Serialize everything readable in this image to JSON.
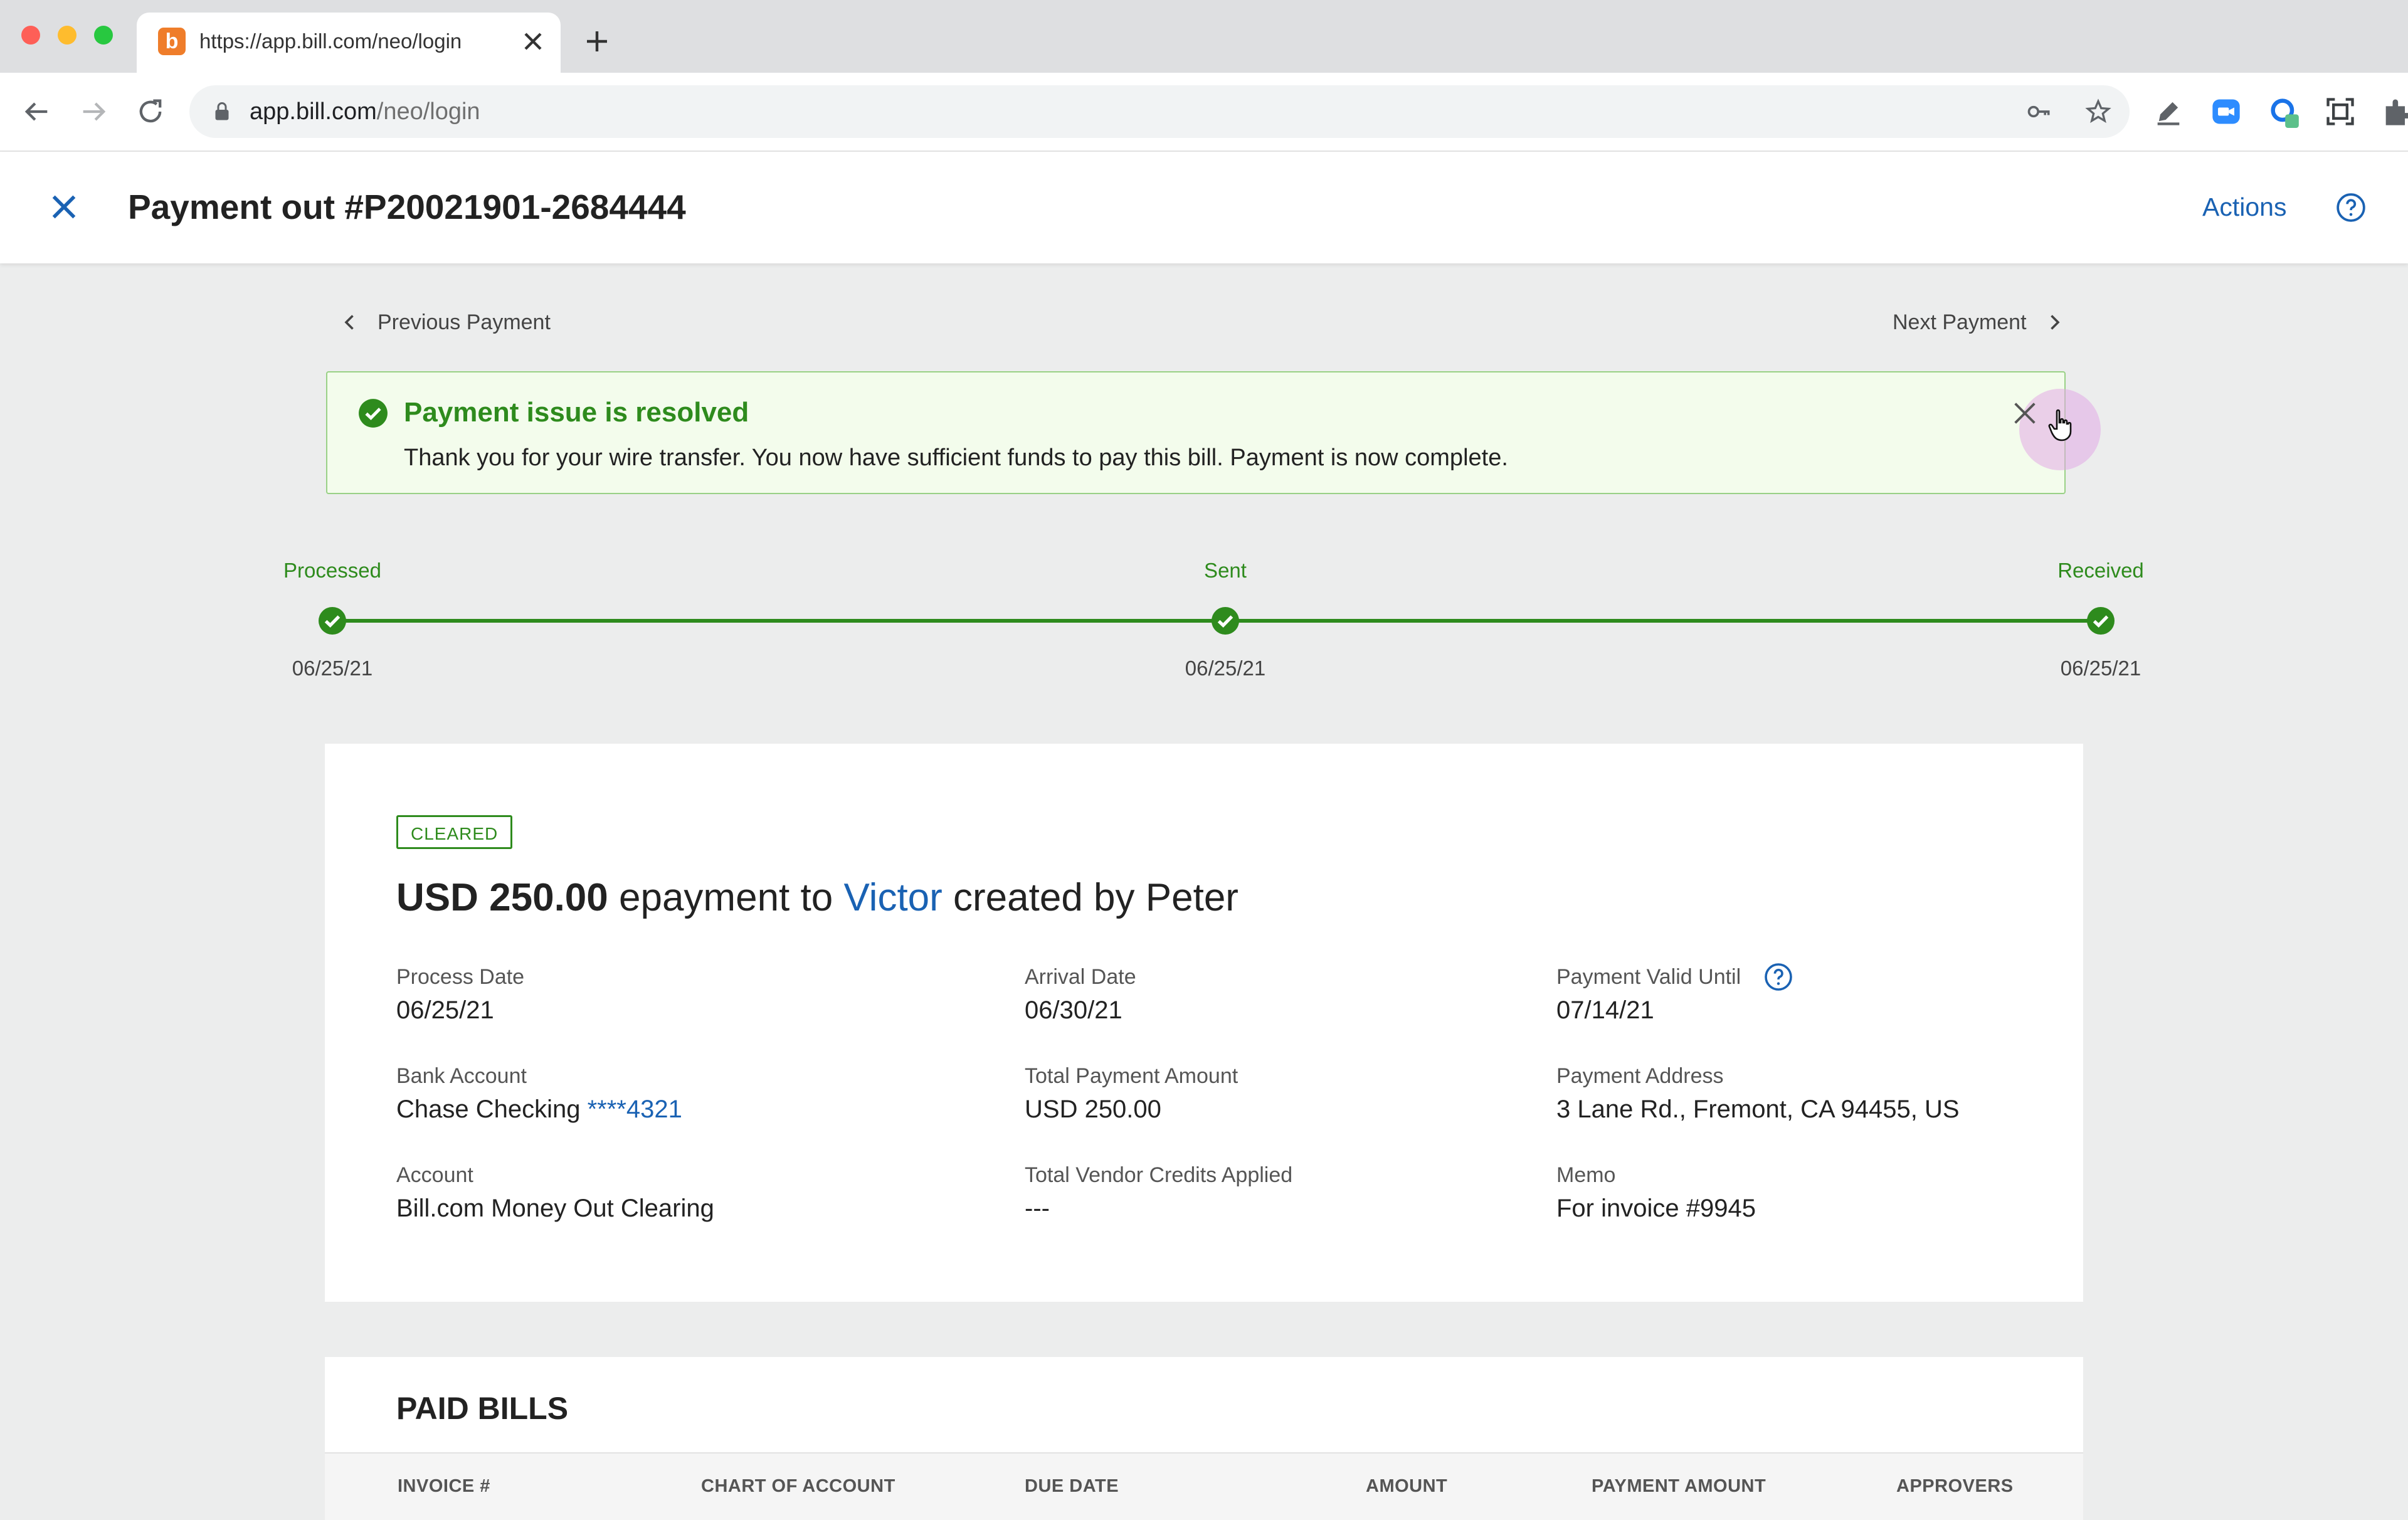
{
  "browser": {
    "tab_title": "https://app.bill.com/neo/login",
    "favicon_letter": "b",
    "url_host": "app.bill.com",
    "url_path": "/neo/login"
  },
  "header": {
    "title": "Payment out #P20021901-2684444",
    "actions_label": "Actions"
  },
  "pager": {
    "previous_label": "Previous Payment",
    "next_label": "Next Payment"
  },
  "alert": {
    "title": "Payment issue is resolved",
    "message": "Thank you for your wire transfer. You now have sufficient funds to pay this bill. Payment is now complete."
  },
  "timeline": {
    "steps": [
      {
        "label": "Processed",
        "date": "06/25/21"
      },
      {
        "label": "Sent",
        "date": "06/25/21"
      },
      {
        "label": "Received",
        "date": "06/25/21"
      }
    ]
  },
  "payment": {
    "status_badge": "CLEARED",
    "amount": "USD 250.00",
    "mid_text": " epayment to ",
    "vendor": "Victor",
    "creator_text": " created by Peter",
    "fields": {
      "process_date": {
        "label": "Process Date",
        "value": "06/25/21"
      },
      "arrival_date": {
        "label": "Arrival Date",
        "value": "06/30/21"
      },
      "valid_until": {
        "label": "Payment Valid Until",
        "value": "07/14/21"
      },
      "bank_account": {
        "label": "Bank Account",
        "value": "Chase Checking ",
        "link": "****4321"
      },
      "total_amount": {
        "label": "Total Payment Amount",
        "value": "USD 250.00"
      },
      "payment_address": {
        "label": "Payment Address",
        "value": "3 Lane Rd., Fremont, CA 94455, US"
      },
      "account": {
        "label": "Account",
        "value": "Bill.com Money Out Clearing"
      },
      "vendor_credits": {
        "label": "Total Vendor Credits Applied",
        "value": "---"
      },
      "memo": {
        "label": "Memo",
        "value": "For invoice #9945"
      }
    }
  },
  "paid_bills": {
    "title": "PAID BILLS",
    "columns": [
      "INVOICE #",
      "CHART OF ACCOUNT",
      "DUE DATE",
      "AMOUNT",
      "PAYMENT AMOUNT",
      "APPROVERS"
    ]
  },
  "colors": {
    "brand_blue": "#1a62b3",
    "success_green": "#2e8b1d",
    "alert_bg": "#f3fcec",
    "favicon_orange": "#ef7d2a"
  },
  "icons": [
    "close-icon",
    "help-icon",
    "chevron-left-icon",
    "chevron-right-icon",
    "check-circle-icon",
    "lock-icon",
    "key-icon",
    "star-icon",
    "reload-icon",
    "back-icon",
    "forward-icon",
    "extensions-icon"
  ]
}
